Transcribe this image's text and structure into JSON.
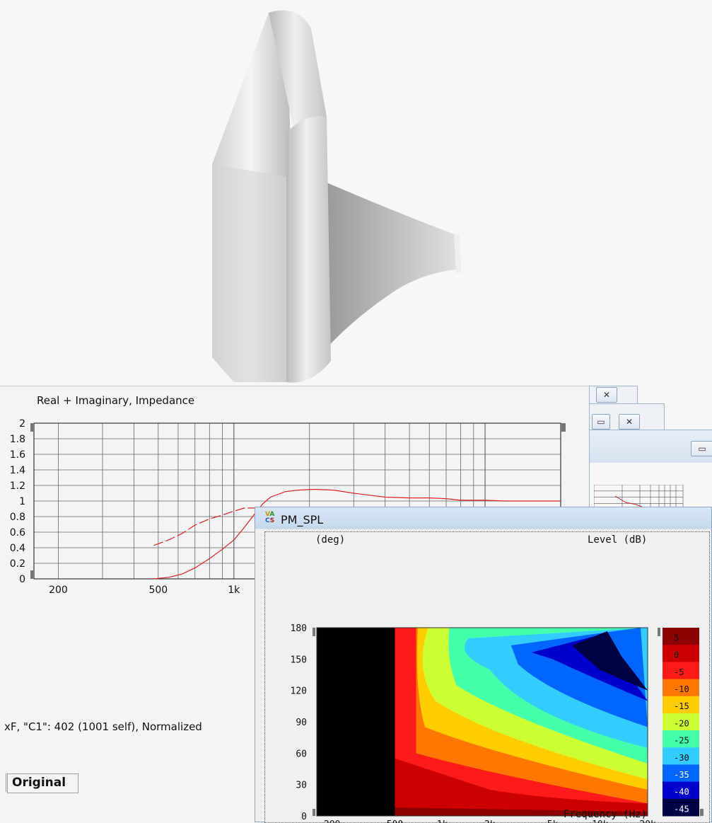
{
  "impedance_window": {
    "title": "Real + Imaginary, Impedance",
    "footer": "xF, \"C1\": 402 (1001 self), Normalized",
    "tab_label": "Original"
  },
  "spl_window": {
    "title": "PM_SPL",
    "app_icon": "vacs-icon",
    "left_unit": "(deg)",
    "right_unit": "Level (dB)",
    "x_label": "Frequency (Hz)"
  },
  "colors": {
    "curve": "#dd2222",
    "grid": "#555555",
    "window_caption": "#d6e4f3"
  },
  "chart_data": [
    {
      "type": "line",
      "title": "Real + Imaginary, Impedance",
      "xscale": "log",
      "xlim": [
        160,
        20000
      ],
      "ylim": [
        0,
        2
      ],
      "x_ticks": [
        "200",
        "500",
        "1k"
      ],
      "y_ticks": [
        "0",
        "0.2",
        "0.4",
        "0.6",
        "0.8",
        "1",
        "1.2",
        "1.4",
        "1.6",
        "1.8",
        "2"
      ],
      "series": [
        {
          "style": "solid",
          "points": [
            [
              480,
              0.0
            ],
            [
              550,
              0.02
            ],
            [
              620,
              0.06
            ],
            [
              700,
              0.14
            ],
            [
              800,
              0.26
            ],
            [
              900,
              0.38
            ],
            [
              1000,
              0.5
            ],
            [
              1100,
              0.66
            ],
            [
              1200,
              0.82
            ],
            [
              1300,
              0.96
            ],
            [
              1400,
              1.05
            ],
            [
              1600,
              1.12
            ],
            [
              1800,
              1.14
            ],
            [
              2100,
              1.15
            ],
            [
              2500,
              1.14
            ],
            [
              3000,
              1.1
            ],
            [
              4000,
              1.05
            ],
            [
              5000,
              1.04
            ],
            [
              6000,
              1.04
            ],
            [
              7000,
              1.03
            ],
            [
              8000,
              1.01
            ],
            [
              10000,
              1.01
            ],
            [
              12000,
              1.0
            ],
            [
              15000,
              1.0
            ],
            [
              18000,
              1.0
            ],
            [
              20000,
              1.0
            ]
          ]
        },
        {
          "style": "dashed",
          "points": [
            [
              480,
              0.43
            ],
            [
              550,
              0.5
            ],
            [
              620,
              0.58
            ],
            [
              700,
              0.69
            ],
            [
              800,
              0.77
            ],
            [
              900,
              0.82
            ],
            [
              1000,
              0.87
            ],
            [
              1100,
              0.91
            ],
            [
              1250,
              0.91
            ],
            [
              1350,
              0.86
            ],
            [
              1450,
              0.81
            ],
            [
              1550,
              0.76
            ]
          ]
        }
      ]
    },
    {
      "type": "heatmap",
      "title": "PM_SPL",
      "xscale": "log",
      "xlim": [
        160,
        20000
      ],
      "ylim": [
        0,
        180
      ],
      "x_ticks": [
        "200",
        "500",
        "1k",
        "2k",
        "5k",
        "10k",
        "20k"
      ],
      "y_ticks": [
        "0",
        "30",
        "60",
        "90",
        "120",
        "150",
        "180"
      ],
      "xlabel": "Frequency (Hz)",
      "ylabel": "(deg)",
      "colorbar_label": "Level (dB)",
      "colorbar_ticks": [
        "5",
        "0",
        "-5",
        "-10",
        "-15",
        "-20",
        "-25",
        "-30",
        "-35",
        "-40",
        "-45"
      ],
      "colorbar_colors": [
        "#8b0000",
        "#cc0000",
        "#ff1a1a",
        "#ff7700",
        "#ffcc00",
        "#ccff33",
        "#44ffaa",
        "#33ccff",
        "#0066ff",
        "#0000cc",
        "#000044"
      ],
      "levels": [
        5,
        0,
        -5,
        -10,
        -15,
        -20,
        -25,
        -30,
        -35,
        -40,
        -45
      ]
    }
  ]
}
